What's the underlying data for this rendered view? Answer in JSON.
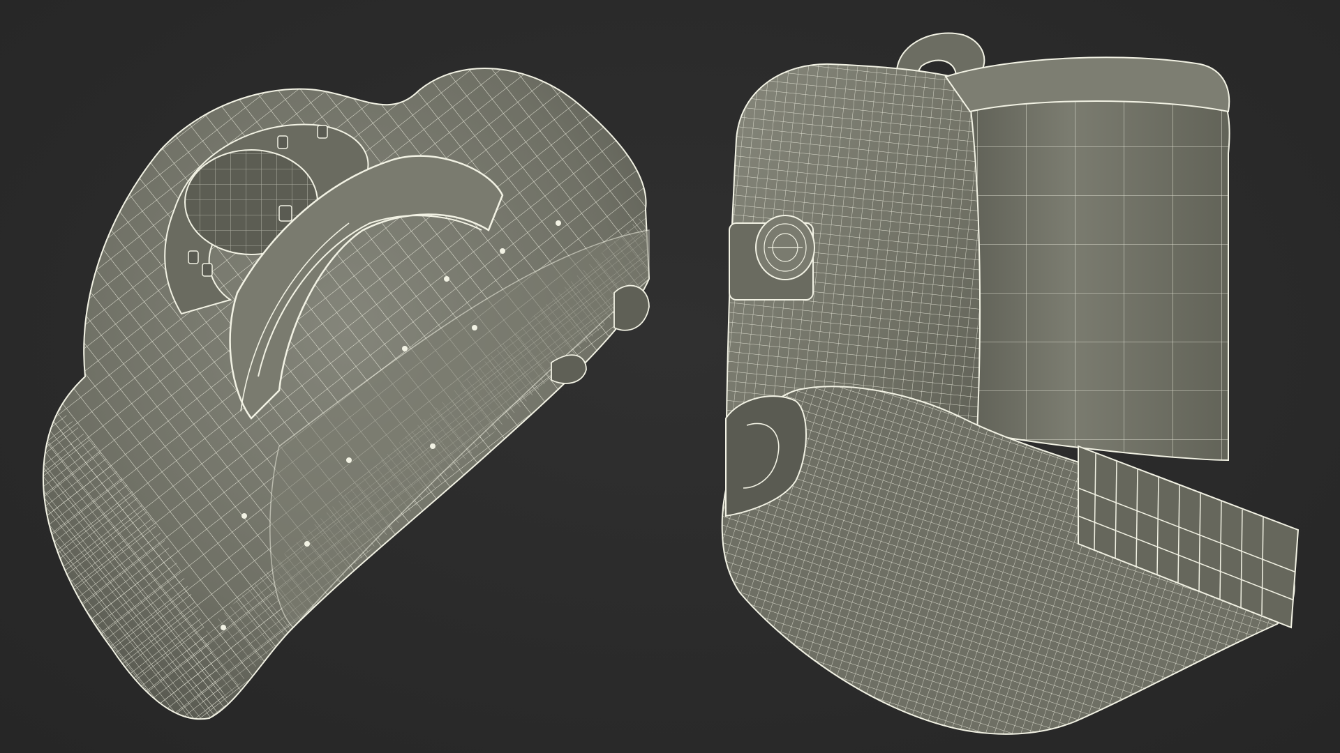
{
  "scene": {
    "background_color": "#2b2b2b",
    "surface_color": "#737468",
    "surface_shadow_color": "#5d5e54",
    "surface_highlight_color": "#8a8b7e",
    "wire_color": "#f2f2e4",
    "objects": [
      {
        "name": "left-view",
        "description_icon": "wireframe-mesh-view"
      },
      {
        "name": "right-view",
        "description_icon": "wireframe-mesh-view"
      }
    ]
  }
}
